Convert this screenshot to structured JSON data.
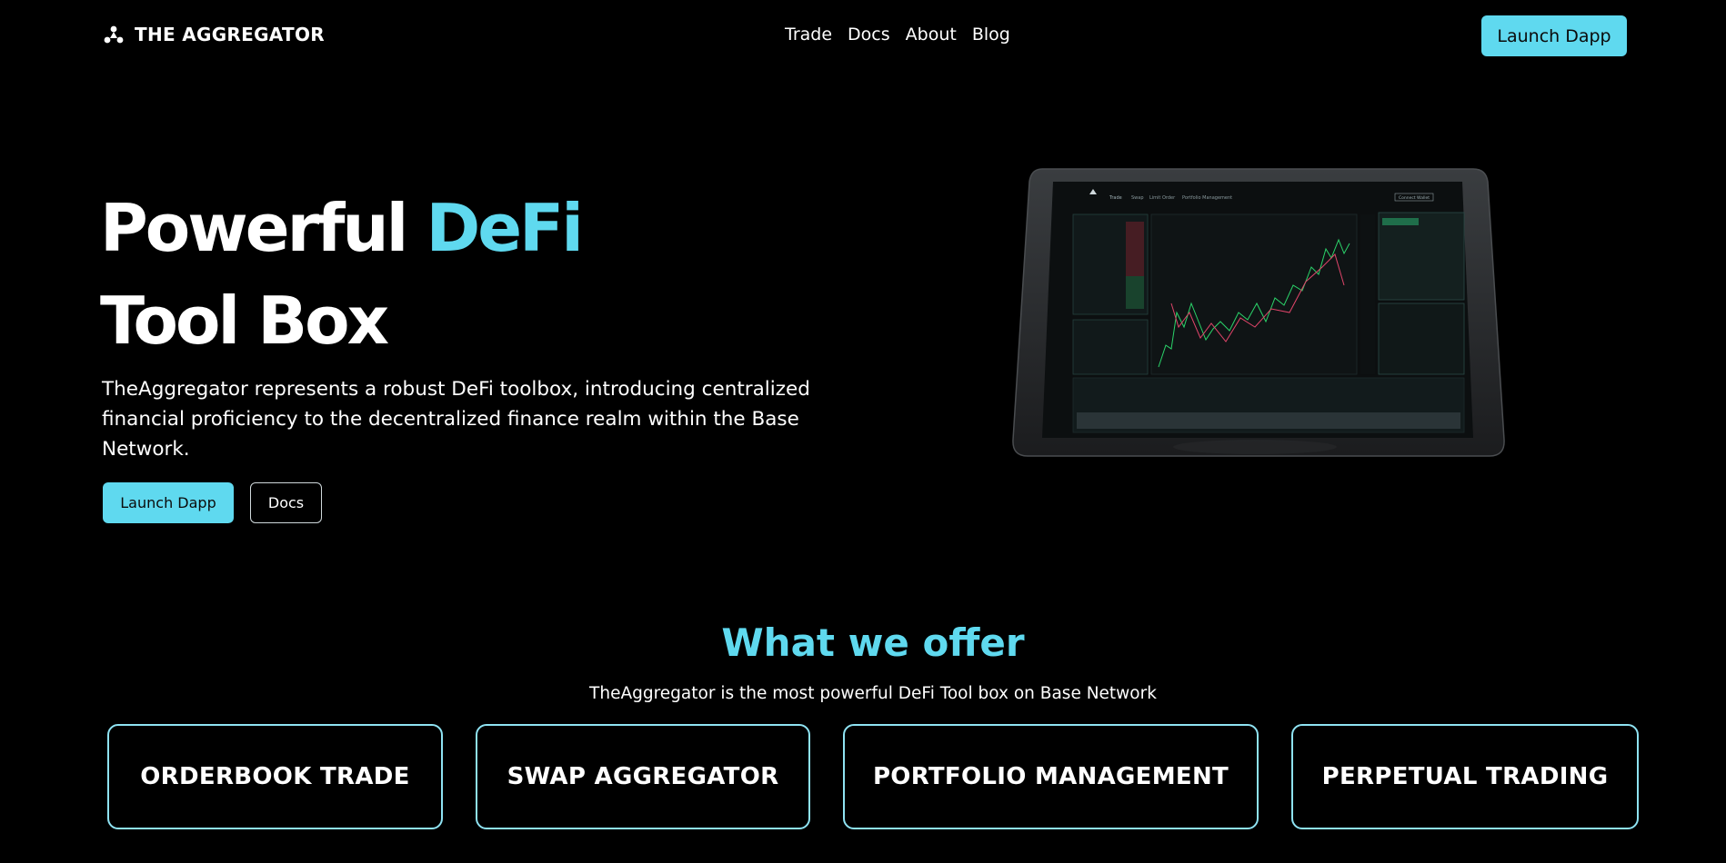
{
  "nav": {
    "brand": "THE AGGREGATOR",
    "links": [
      "Trade",
      "Docs",
      "About",
      "Blog"
    ],
    "cta": "Launch Dapp"
  },
  "hero": {
    "title_line1": "Powerful",
    "title_accent": "DeFi",
    "title_line2": "Tool Box",
    "description": "TheAggregator represents a robust DeFi toolbox, introducing centralized financial proficiency to the decentralized finance realm within the Base Network.",
    "primary_button": "Launch Dapp",
    "secondary_button": "Docs"
  },
  "offer": {
    "title": "What we offer",
    "subtitle": "TheAggregator is the most powerful DeFi Tool box on Base Network",
    "cards": [
      "ORDERBOOK TRADE",
      "SWAP AGGREGATOR",
      "PORTFOLIO MANAGEMENT",
      "PERPETUAL TRADING"
    ]
  },
  "device_screen": {
    "tabs": [
      "Trade",
      "Swap",
      "Limit Order",
      "Portfolio Management"
    ],
    "connect": "Connect Wallet"
  },
  "colors": {
    "accent": "#5fd9ef",
    "background": "#000000",
    "card_border": "#8fe3f3"
  },
  "icons": {
    "logo": "triangle-dots-logo-icon"
  }
}
